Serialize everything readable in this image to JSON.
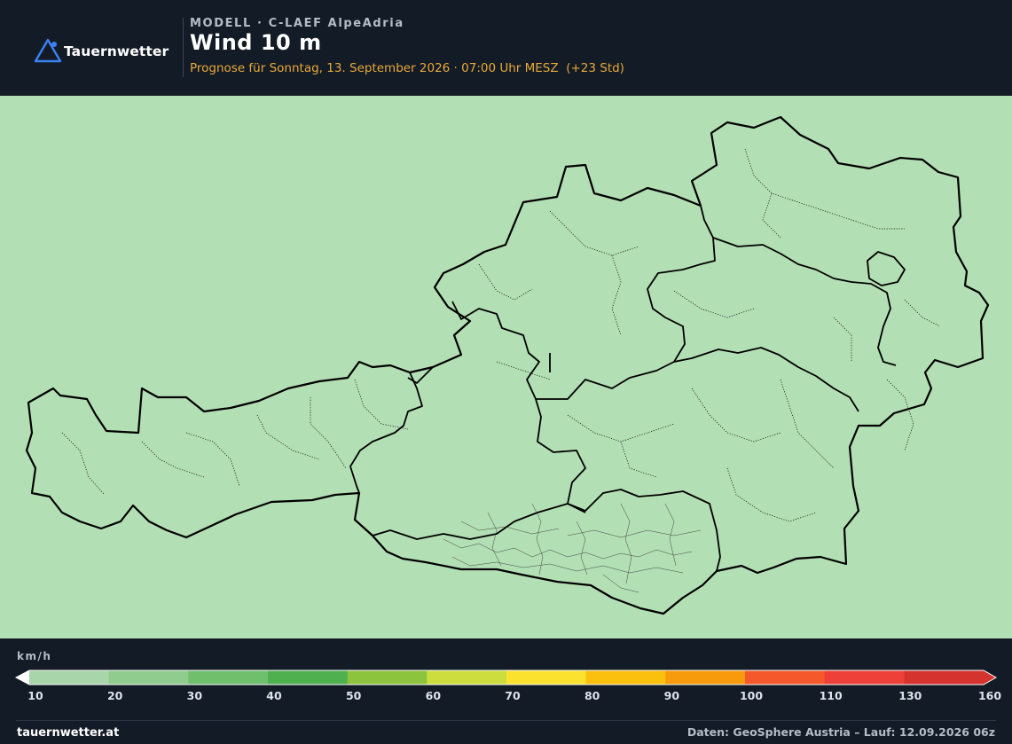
{
  "brand": {
    "name": "Tauernwetter",
    "logo_icon": "mountain-triangle-icon",
    "accent": "#3b82f6"
  },
  "header": {
    "model_line": "MODELL · C-LAEF AlpeAdria",
    "title": "Wind 10 m",
    "subtitle": "Prognose für Sonntag, 13. September 2026 · 07:00 Uhr MESZ  (+23 Std)"
  },
  "map": {
    "region": "Österreich",
    "field": "Windgeschwindigkeit 10 m",
    "dominant_class": "10–20 km/h",
    "dominant_color": "#b3dfb4"
  },
  "legend": {
    "unit": "km/h",
    "ticks": [
      "10",
      "20",
      "30",
      "40",
      "50",
      "60",
      "70",
      "80",
      "90",
      "100",
      "110",
      "130",
      "160"
    ],
    "colors": [
      "#a8d5a9",
      "#8fcc8d",
      "#6fbf6d",
      "#4fb04f",
      "#8dc43d",
      "#cedd3e",
      "#fbe22e",
      "#fbbf0e",
      "#f79a0c",
      "#f5582a",
      "#ee4038",
      "#d5332e"
    ],
    "below_min_color": "#ffffff",
    "above_max_color": "#d5332e"
  },
  "footer": {
    "site": "tauernwetter.at",
    "source": "Daten: GeoSphere Austria – Lauf: 12.09.2026 06z"
  }
}
